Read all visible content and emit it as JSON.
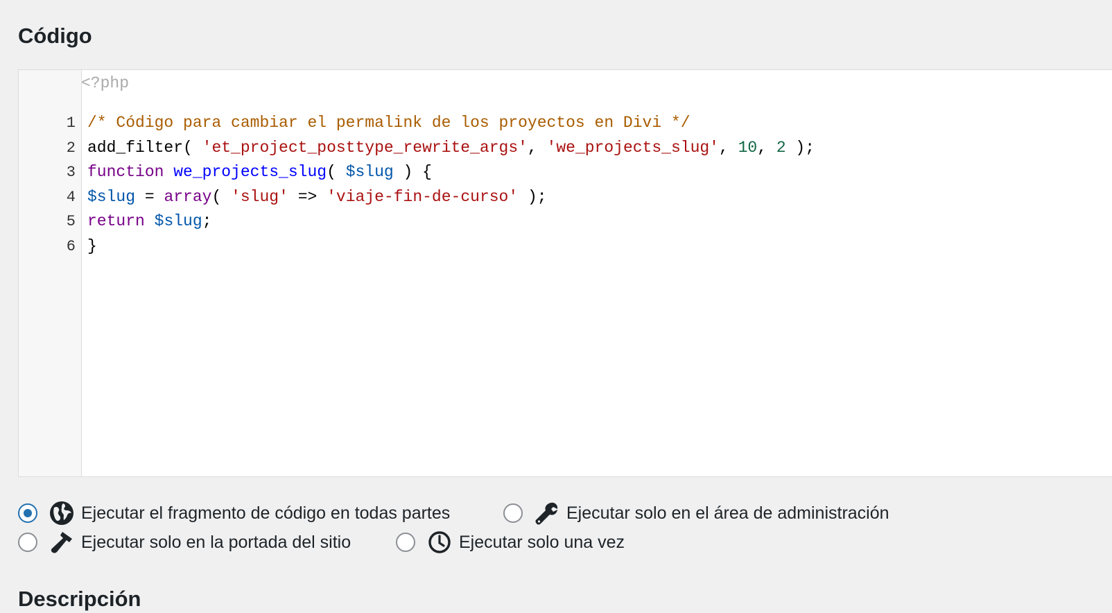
{
  "code_section": {
    "title": "Código",
    "php_open_tag": "<?php",
    "lines": [
      {
        "n": "1",
        "tokens": [
          {
            "t": "comment",
            "v": "/* Código para cambiar el permalink de los proyectos en Divi */"
          }
        ]
      },
      {
        "n": "2",
        "tokens": [
          {
            "t": "plain",
            "v": "add_filter( "
          },
          {
            "t": "string",
            "v": "'et_project_posttype_rewrite_args'"
          },
          {
            "t": "plain",
            "v": ", "
          },
          {
            "t": "string",
            "v": "'we_projects_slug'"
          },
          {
            "t": "plain",
            "v": ", "
          },
          {
            "t": "number",
            "v": "10"
          },
          {
            "t": "plain",
            "v": ", "
          },
          {
            "t": "number",
            "v": "2"
          },
          {
            "t": "plain",
            "v": " );"
          }
        ]
      },
      {
        "n": "3",
        "tokens": [
          {
            "t": "keyword",
            "v": "function"
          },
          {
            "t": "plain",
            "v": " "
          },
          {
            "t": "def",
            "v": "we_projects_slug"
          },
          {
            "t": "plain",
            "v": "( "
          },
          {
            "t": "var",
            "v": "$slug"
          },
          {
            "t": "plain",
            "v": " ) {"
          }
        ]
      },
      {
        "n": "4",
        "tokens": [
          {
            "t": "var",
            "v": "$slug"
          },
          {
            "t": "plain",
            "v": " = "
          },
          {
            "t": "builtin",
            "v": "array"
          },
          {
            "t": "plain",
            "v": "( "
          },
          {
            "t": "string",
            "v": "'slug'"
          },
          {
            "t": "plain",
            "v": " => "
          },
          {
            "t": "string",
            "v": "'viaje-fin-de-curso'"
          },
          {
            "t": "plain",
            "v": " );"
          }
        ]
      },
      {
        "n": "5",
        "tokens": [
          {
            "t": "keyword",
            "v": "return"
          },
          {
            "t": "plain",
            "v": " "
          },
          {
            "t": "var",
            "v": "$slug"
          },
          {
            "t": "plain",
            "v": ";"
          }
        ]
      },
      {
        "n": "6",
        "tokens": [
          {
            "t": "plain",
            "v": "}"
          }
        ]
      }
    ]
  },
  "scope_options": {
    "everywhere": {
      "label": "Ejecutar el fragmento de código en todas partes",
      "icon": "globe-icon",
      "selected": true
    },
    "admin": {
      "label": "Ejecutar solo en el área de administración",
      "icon": "wrench-icon",
      "selected": false
    },
    "front_end": {
      "label": "Ejecutar solo en la portada del sitio",
      "icon": "hammer-icon",
      "selected": false
    },
    "single_use": {
      "label": "Ejecutar solo una vez",
      "icon": "clock-icon",
      "selected": false
    }
  },
  "description_section": {
    "title": "Descripción"
  },
  "colors": {
    "comment": "#a95c00",
    "string": "#aa1111",
    "number": "#116644",
    "keyword": "#770088",
    "def": "#0000ff",
    "variable": "#0055aa",
    "radio_checked": "#2271b1"
  }
}
